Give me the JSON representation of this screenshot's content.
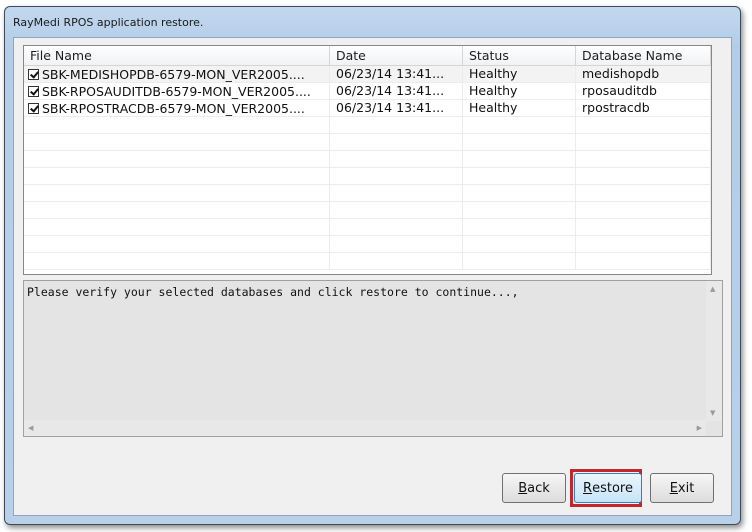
{
  "window": {
    "title": "RayMedi RPOS application restore."
  },
  "grid": {
    "columns": [
      "File Name",
      "Date",
      "Status",
      "Database Name"
    ],
    "rows": [
      {
        "file": "SBK-MEDISHOPDB-6579-MON_VER2005....",
        "date": "06/23/14 13:41...",
        "status": "Healthy",
        "db": "medishopdb",
        "checked": true
      },
      {
        "file": "SBK-RPOSAUDITDB-6579-MON_VER2005....",
        "date": "06/23/14 13:41...",
        "status": "Healthy",
        "db": "rposauditdb",
        "checked": true
      },
      {
        "file": "SBK-RPOSTRACDB-6579-MON_VER2005....",
        "date": "06/23/14 13:41...",
        "status": "Healthy",
        "db": "rpostracdb",
        "checked": true
      }
    ]
  },
  "message": "Please verify your selected databases and click restore to continue...,",
  "buttons": {
    "back_accel": "B",
    "back_rest": "ack",
    "restore_accel": "R",
    "restore_rest": "estore",
    "exit_accel": "E",
    "exit_rest": "xit"
  }
}
